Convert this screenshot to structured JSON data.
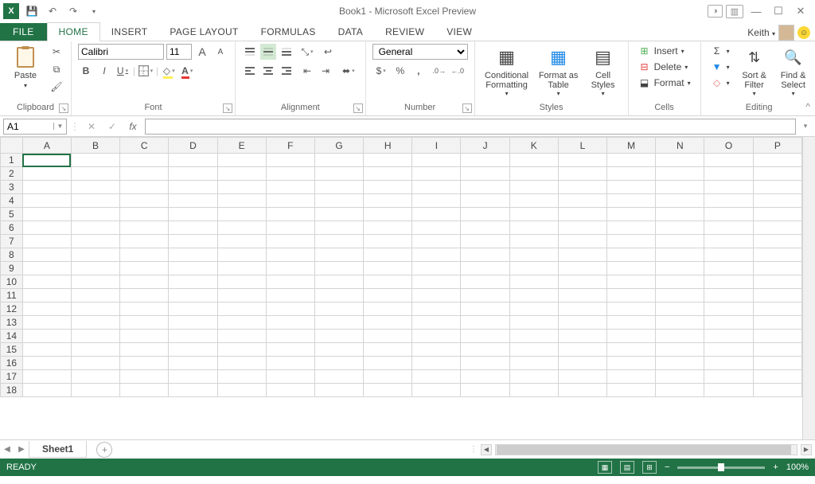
{
  "title": "Book1 - Microsoft Excel Preview",
  "qat": {
    "save": "save-icon",
    "undo": "undo-icon",
    "redo": "redo-icon",
    "customize": "▾"
  },
  "user": {
    "name": "Keith",
    "dropdown": "▾"
  },
  "window": {
    "help": "?",
    "fullscreen_a": "⬚",
    "fullscreen_b": "▣",
    "min": "—",
    "max": "☐",
    "close": "✕"
  },
  "tabs": {
    "file": "FILE",
    "active": "HOME",
    "items": [
      "HOME",
      "INSERT",
      "PAGE LAYOUT",
      "FORMULAS",
      "DATA",
      "REVIEW",
      "VIEW"
    ]
  },
  "ribbon": {
    "clipboard": {
      "label": "Clipboard",
      "paste": "Paste",
      "cut": "cut-icon",
      "copy": "copy-icon",
      "painter": "format-painter-icon"
    },
    "font": {
      "label": "Font",
      "name": "Calibri",
      "size": "11",
      "grow": "A",
      "shrink": "A",
      "bold": "B",
      "italic": "I",
      "underline": "U",
      "border": "borders-icon",
      "fill": "fill-color-icon",
      "color": "font-color-icon"
    },
    "alignment": {
      "label": "Alignment",
      "wrap": "wrap-text-icon",
      "merge": "merge-center-icon"
    },
    "number": {
      "label": "Number",
      "format": "General",
      "currency": "$",
      "percent": "%",
      "comma": ",",
      "inc": ".00→.0",
      "dec": ".0→.00"
    },
    "styles": {
      "label": "Styles",
      "cond": "Conditional Formatting",
      "table": "Format as Table",
      "cell": "Cell Styles"
    },
    "cells": {
      "label": "Cells",
      "insert": "Insert",
      "delete": "Delete",
      "format": "Format"
    },
    "editing": {
      "label": "Editing",
      "sum": "Σ",
      "fill": "fill-icon",
      "clear": "clear-icon",
      "sort": "Sort & Filter",
      "find": "Find & Select"
    }
  },
  "formula": {
    "cell": "A1",
    "cancel": "✕",
    "enter": "✓",
    "fx": "fx",
    "value": ""
  },
  "grid": {
    "cols": [
      "A",
      "B",
      "C",
      "D",
      "E",
      "F",
      "G",
      "H",
      "I",
      "J",
      "K",
      "L",
      "M",
      "N",
      "O",
      "P"
    ],
    "rows": 18,
    "selected": "A1"
  },
  "sheets": {
    "active": "Sheet1",
    "add": "+"
  },
  "status": {
    "ready": "READY",
    "zoom": "100%",
    "minus": "−",
    "plus": "+"
  }
}
